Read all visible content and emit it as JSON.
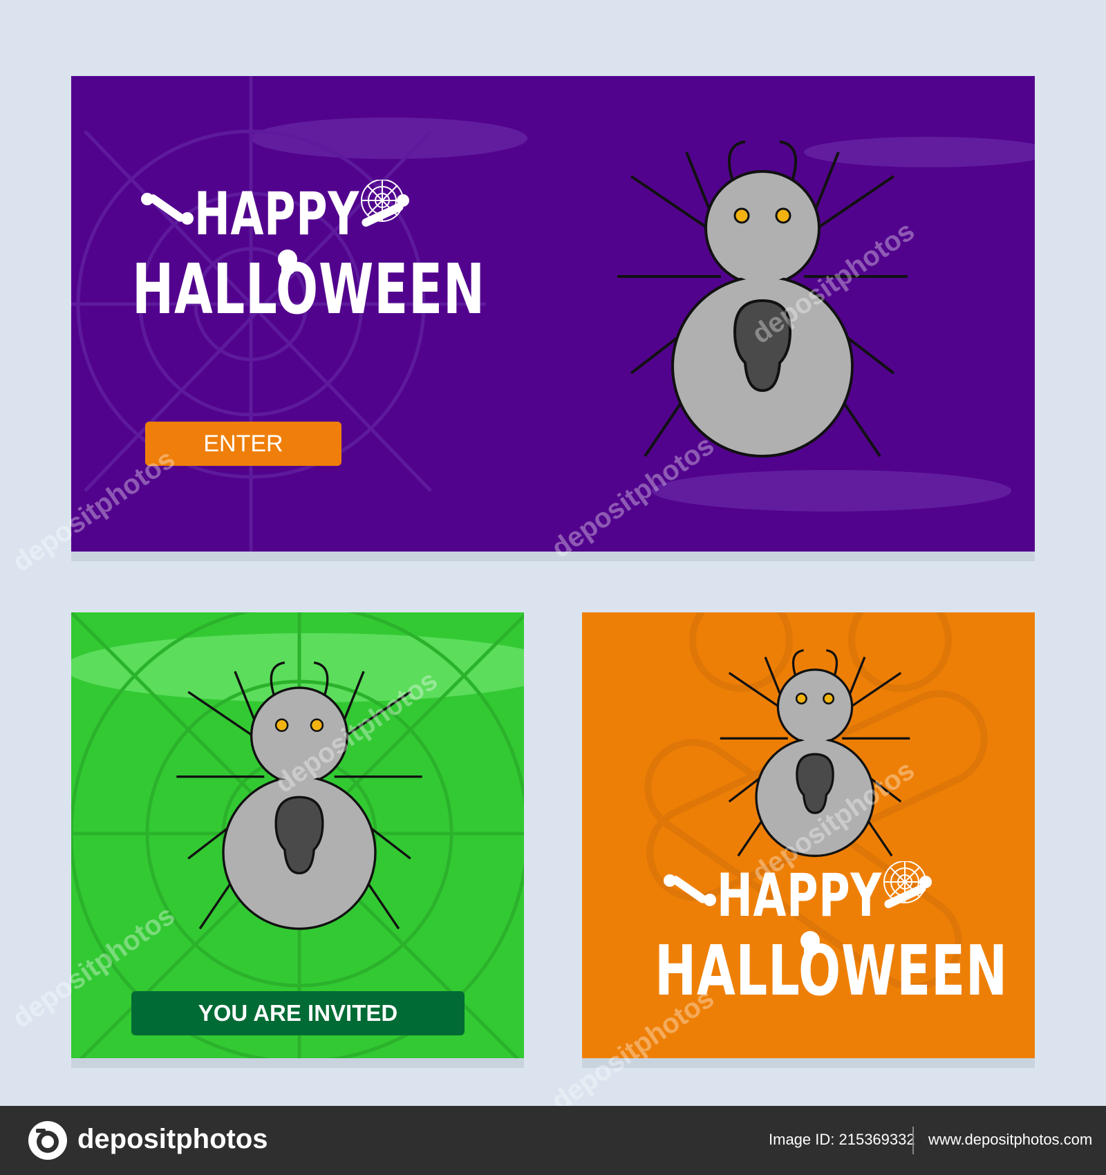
{
  "cards": {
    "top": {
      "greeting_line1": "HAPPY",
      "greeting_line2": "HALLOWEEN",
      "button_label": "ENTER"
    },
    "green": {
      "badge_label": "YOU ARE INVITED"
    },
    "orange": {
      "greeting_line1": "HAPPY",
      "greeting_line2": "HALLOWEEN"
    }
  },
  "watermark_text": "depositphotos",
  "footer": {
    "brand": "depositphotos",
    "image_id": "Image ID: 215369332",
    "site": "www.depositphotos.com"
  },
  "colors": {
    "page_bg": "#dbe4ee",
    "purple": "#52038d",
    "green": "#33c933",
    "orange": "#ee7f06",
    "button_orange": "#ef7f0a",
    "badge_green": "#006b34",
    "spider_gray": "#b0b0b0",
    "spider_dark": "#4a4a4a",
    "eye_yellow": "#f2b311"
  },
  "icons": {
    "spider": "spider-icon",
    "cobweb": "cobweb-icon",
    "skull": "skull-icon",
    "bone": "bone-icon",
    "camera": "camera-icon"
  }
}
